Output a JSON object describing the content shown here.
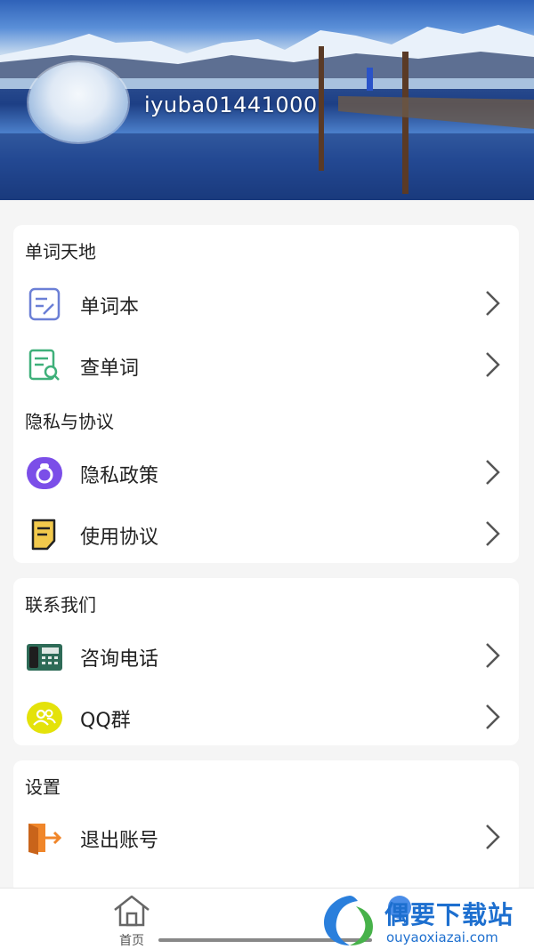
{
  "header": {
    "username": "iyuba01441000"
  },
  "sections": {
    "words": {
      "title": "单词天地",
      "items": [
        {
          "label": "单词本",
          "icon": "notebook-edit-icon"
        },
        {
          "label": "查单词",
          "icon": "search-document-icon"
        }
      ]
    },
    "privacy": {
      "title": "隐私与协议",
      "items": [
        {
          "label": "隐私政策",
          "icon": "privacy-lock-icon"
        },
        {
          "label": "使用协议",
          "icon": "agreement-note-icon"
        }
      ]
    },
    "contact": {
      "title": "联系我们",
      "items": [
        {
          "label": "咨询电话",
          "icon": "telephone-icon"
        },
        {
          "label": "QQ群",
          "icon": "qq-group-icon"
        }
      ]
    },
    "settings": {
      "title": "设置",
      "items": [
        {
          "label": "退出账号",
          "icon": "logout-icon"
        }
      ]
    }
  },
  "bottom_nav": {
    "home_label": "首页"
  },
  "watermark": {
    "title": "偶要下载站",
    "subtitle": "ouyaoxiazai.com"
  },
  "colors": {
    "accent_blue": "#1d6fcf",
    "privacy_purple": "#7b4ee8",
    "qq_yellow": "#e4e20a",
    "logout_orange": "#f0862a"
  }
}
